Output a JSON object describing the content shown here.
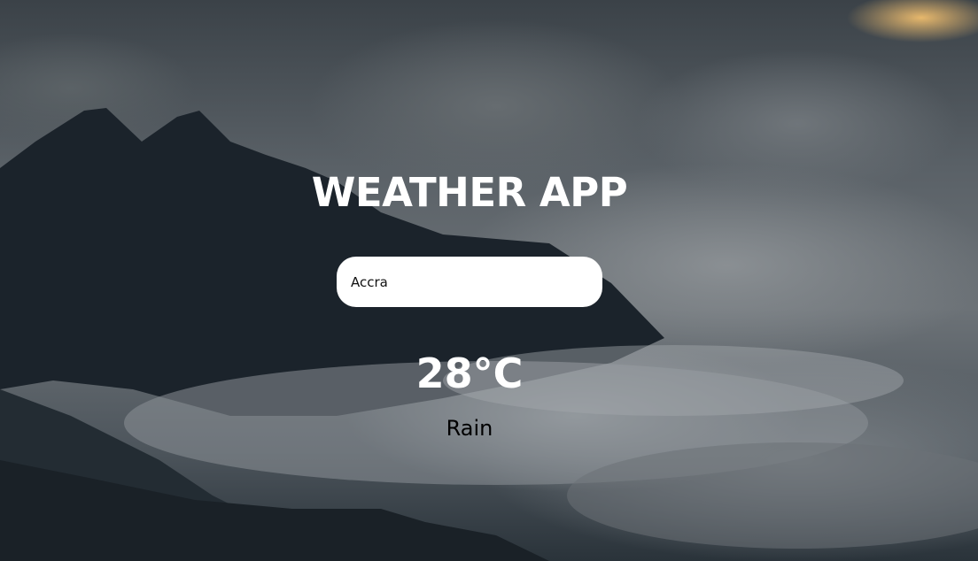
{
  "app": {
    "title": "WEATHER APP"
  },
  "search": {
    "value": "Accra",
    "placeholder": ""
  },
  "weather": {
    "temperature": "28°C",
    "condition": "Rain"
  },
  "colors": {
    "title_text": "#ffffff",
    "temperature_text": "#ffffff",
    "condition_text": "#000000",
    "search_background": "#ffffff"
  }
}
